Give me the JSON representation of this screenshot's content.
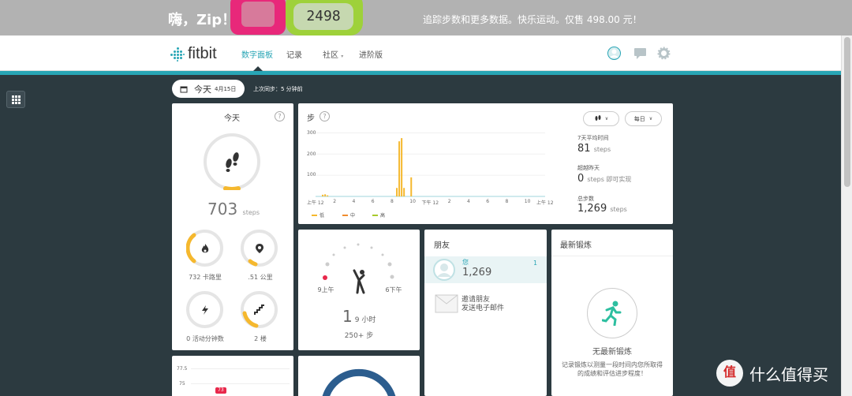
{
  "ad": {
    "left_text": "嗨，Zip！",
    "right_text": "追踪步数和更多数据。快乐运动。仅售 498.00 元！",
    "device_display": "2498"
  },
  "nav": {
    "logo": "fitbit",
    "links": [
      "数字面板",
      "记录",
      "社区",
      "进阶版"
    ]
  },
  "date_bar": {
    "today_label": "今天",
    "date": "4月15日",
    "last_sync": "上次同步：5 分钟前"
  },
  "today_panel": {
    "title": "今天",
    "help": "?",
    "steps_value": "703",
    "steps_unit": "steps",
    "stats": [
      {
        "icon": "flame-icon",
        "value": "732",
        "unit": "卡路里",
        "progress": 0.35
      },
      {
        "icon": "location-pin-icon",
        "value": ".51",
        "unit": "公里",
        "progress": 0.1
      },
      {
        "icon": "lightning-icon",
        "value": "0",
        "unit": "活动分钟数",
        "progress": 0
      },
      {
        "icon": "stairs-icon",
        "value": "2",
        "unit": "楼",
        "progress": 0.2
      }
    ],
    "steps_progress": 0.07
  },
  "steps_panel": {
    "title": "步",
    "help": "?",
    "filter_btn": "▼",
    "period_btn": "每日",
    "side": [
      {
        "label": "7天平均时间",
        "value": "81",
        "unit": "steps"
      },
      {
        "label": "超越昨天",
        "value": "0",
        "unit": "steps 即可实现"
      },
      {
        "label": "总步数",
        "value": "1,269",
        "unit": "steps"
      }
    ],
    "legend": [
      "低",
      "中",
      "高"
    ]
  },
  "chart_data": {
    "type": "bar",
    "title": "步",
    "y_ticks": [
      "300",
      "200",
      "100"
    ],
    "x_ticks": [
      "上午 12",
      "2",
      "4",
      "6",
      "8",
      "10",
      "下午 12",
      "2",
      "4",
      "6",
      "8",
      "10",
      "上午 12"
    ],
    "ylim": [
      0,
      320
    ],
    "bars": [
      {
        "hour": 0.75,
        "value": 8
      },
      {
        "hour": 1.0,
        "value": 10
      },
      {
        "hour": 1.25,
        "value": 5
      },
      {
        "hour": 8.5,
        "value": 40
      },
      {
        "hour": 8.75,
        "value": 260
      },
      {
        "hour": 9.0,
        "value": 275
      },
      {
        "hour": 9.25,
        "value": 40
      },
      {
        "hour": 10.0,
        "value": 90
      }
    ],
    "series": [
      {
        "name": "低",
        "color": "#f5b82e"
      },
      {
        "name": "中",
        "color": "#f08c2e"
      },
      {
        "name": "高",
        "color": "#a8c92c"
      }
    ]
  },
  "hourly_panel": {
    "start": "9上午",
    "end": "6下午",
    "active_hours": "1",
    "active_hours_total": "9 小时",
    "steps_goal": "250+ 步"
  },
  "friends_panel": {
    "title": "朋友",
    "friend_name": "您",
    "friend_steps": "1,269",
    "rank": "1",
    "invite_line1": "邀请朋友",
    "invite_line2": "发送电子邮件"
  },
  "exercise_panel": {
    "title": "最新锻炼",
    "empty_title": "无最新锻炼",
    "empty_desc": "记录锻炼以测量一段时间内您所取得的成绩和评估进步程度！"
  },
  "weight_panel": {
    "y_ticks": [
      "77.5",
      "75"
    ],
    "badge": "73"
  },
  "watermark": {
    "logo": "值",
    "text": "什么值得买"
  }
}
